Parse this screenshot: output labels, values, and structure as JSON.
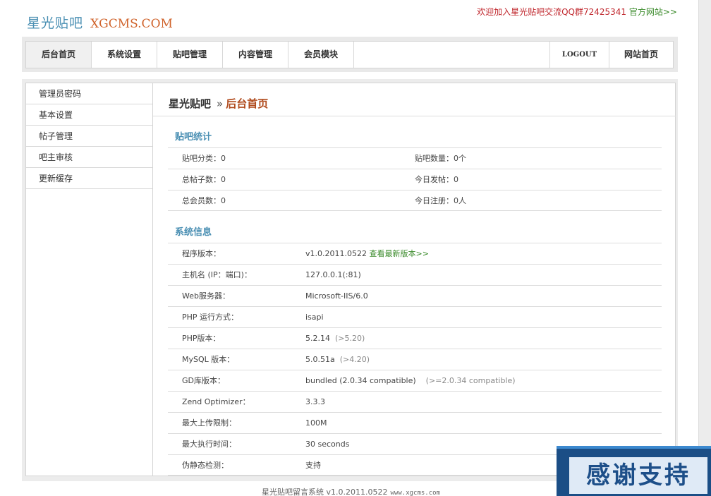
{
  "header": {
    "logo_cn": "星光贴吧",
    "logo_en": "XGCMS.COM",
    "join_text": "欢迎加入星光贴吧交流QQ群72425341",
    "site_link": "官方网站>>"
  },
  "nav": {
    "items": [
      "后台首页",
      "系统设置",
      "贴吧管理",
      "内容管理",
      "会员模块"
    ],
    "right": [
      "LOGOUT",
      "网站首页"
    ]
  },
  "sidebar": {
    "items": [
      "管理员密码",
      "基本设置",
      "帖子管理",
      "吧主审核",
      "更新缓存"
    ]
  },
  "main": {
    "breadcrumb_site": "星光贴吧",
    "breadcrumb_sep": "»",
    "breadcrumb_current": "后台首页",
    "stats_title": "贴吧统计",
    "stats": [
      {
        "l1": "贴吧分类：0",
        "l2": "贴吧数量：0个"
      },
      {
        "l1": "总帖子数：0",
        "l2": "今日发帖：0"
      },
      {
        "l1": "总会员数：0",
        "l2": "今日注册：0人"
      }
    ],
    "sys_title": "系统信息",
    "sys": [
      {
        "label": "程序版本：",
        "value": "v1.0.2011.0522",
        "link": "查看最新版本>>"
      },
      {
        "label": "主机名 (IP：端口)：",
        "value": "127.0.0.1(:81)"
      },
      {
        "label": "Web服务器：",
        "value": "Microsoft-IIS/6.0"
      },
      {
        "label": "PHP 运行方式：",
        "value": "isapi"
      },
      {
        "label": "PHP版本：",
        "value": "5.2.14",
        "note": "(>5.20)"
      },
      {
        "label": "MySQL 版本：",
        "value": "5.0.51a",
        "note": "(>4.20)"
      },
      {
        "label": "GD库版本：",
        "value": "bundled (2.0.34 compatible)",
        "note": "(>=2.0.34 compatible)"
      },
      {
        "label": "Zend Optimizer：",
        "value": "3.3.3"
      },
      {
        "label": "最大上传限制：",
        "value": "100M"
      },
      {
        "label": "最大执行时间：",
        "value": "30 seconds"
      },
      {
        "label": "伪静态检测：",
        "value": "支持"
      }
    ]
  },
  "footer": {
    "text": "星光贴吧留言系统 v1.0.2011.0522",
    "url": "www.xgcms.com"
  },
  "badge": {
    "text": "感谢支持"
  }
}
